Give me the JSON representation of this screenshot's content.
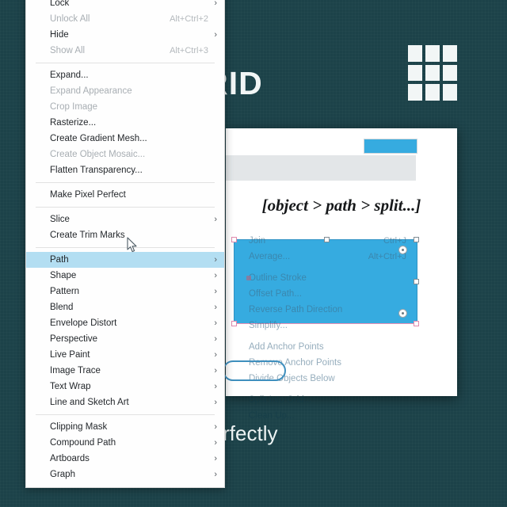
{
  "slide": {
    "title": "O GRID",
    "subtitle": "ting layouts with perfectly\ners.",
    "grid_icon": "grid-3x3-icon",
    "bg_color": "#1c4249",
    "accent_color": "#36abe0",
    "text_color": "#f2f6f6"
  },
  "panel": {
    "caption": "[object > path > split...]",
    "blue_bar_color": "#36abe0",
    "selection_color": "#36abe0"
  },
  "context_menu": {
    "items": [
      {
        "label": "Lock",
        "shortcut": "",
        "caret": "›",
        "state": "normal"
      },
      {
        "label": "Unlock All",
        "shortcut": "Alt+Ctrl+2",
        "caret": "",
        "state": "disabled"
      },
      {
        "label": "Hide",
        "shortcut": "",
        "caret": "›",
        "state": "normal"
      },
      {
        "label": "Show All",
        "shortcut": "Alt+Ctrl+3",
        "caret": "",
        "state": "disabled"
      },
      {
        "separator": true
      },
      {
        "label": "Expand...",
        "shortcut": "",
        "caret": "",
        "state": "normal"
      },
      {
        "label": "Expand Appearance",
        "shortcut": "",
        "caret": "",
        "state": "disabled"
      },
      {
        "label": "Crop Image",
        "shortcut": "",
        "caret": "",
        "state": "disabled"
      },
      {
        "label": "Rasterize...",
        "shortcut": "",
        "caret": "",
        "state": "normal"
      },
      {
        "label": "Create Gradient Mesh...",
        "shortcut": "",
        "caret": "",
        "state": "normal"
      },
      {
        "label": "Create Object Mosaic...",
        "shortcut": "",
        "caret": "",
        "state": "disabled"
      },
      {
        "label": "Flatten Transparency...",
        "shortcut": "",
        "caret": "",
        "state": "normal"
      },
      {
        "separator": true
      },
      {
        "label": "Make Pixel Perfect",
        "shortcut": "",
        "caret": "",
        "state": "normal"
      },
      {
        "separator": true
      },
      {
        "label": "Slice",
        "shortcut": "",
        "caret": "›",
        "state": "normal"
      },
      {
        "label": "Create Trim Marks",
        "shortcut": "",
        "caret": "",
        "state": "normal"
      },
      {
        "separator": true
      },
      {
        "label": "Path",
        "shortcut": "",
        "caret": "›",
        "state": "selected"
      },
      {
        "label": "Shape",
        "shortcut": "",
        "caret": "›",
        "state": "normal"
      },
      {
        "label": "Pattern",
        "shortcut": "",
        "caret": "›",
        "state": "normal"
      },
      {
        "label": "Blend",
        "shortcut": "",
        "caret": "›",
        "state": "normal"
      },
      {
        "label": "Envelope Distort",
        "shortcut": "",
        "caret": "›",
        "state": "normal"
      },
      {
        "label": "Perspective",
        "shortcut": "",
        "caret": "›",
        "state": "normal"
      },
      {
        "label": "Live Paint",
        "shortcut": "",
        "caret": "›",
        "state": "normal"
      },
      {
        "label": "Image Trace",
        "shortcut": "",
        "caret": "›",
        "state": "normal"
      },
      {
        "label": "Text Wrap",
        "shortcut": "",
        "caret": "›",
        "state": "normal"
      },
      {
        "label": "Line and Sketch Art",
        "shortcut": "",
        "caret": "›",
        "state": "normal"
      },
      {
        "separator": true
      },
      {
        "label": "Clipping Mask",
        "shortcut": "",
        "caret": "›",
        "state": "normal"
      },
      {
        "label": "Compound Path",
        "shortcut": "",
        "caret": "›",
        "state": "normal"
      },
      {
        "label": "Artboards",
        "shortcut": "",
        "caret": "›",
        "state": "normal"
      },
      {
        "label": "Graph",
        "shortcut": "",
        "caret": "›",
        "state": "normal"
      }
    ]
  },
  "path_submenu": {
    "items": [
      {
        "label": "Join",
        "shortcut": "Ctrl+J"
      },
      {
        "label": "Average...",
        "shortcut": "Alt+Ctrl+J"
      },
      {
        "separator": true
      },
      {
        "label": "Outline Stroke",
        "shortcut": ""
      },
      {
        "label": "Offset Path...",
        "shortcut": ""
      },
      {
        "label": "Reverse Path Direction",
        "shortcut": ""
      },
      {
        "label": "Simplify...",
        "shortcut": ""
      },
      {
        "separator": true
      },
      {
        "label": "Add Anchor Points",
        "shortcut": ""
      },
      {
        "label": "Remove Anchor Points",
        "shortcut": ""
      },
      {
        "label": "Divide Objects Below",
        "shortcut": ""
      },
      {
        "separator": true
      },
      {
        "label": "Split Into Grid...",
        "shortcut": ""
      },
      {
        "label": "Clean Up...",
        "shortcut": ""
      }
    ]
  },
  "annotation": {
    "shape": "ellipse-highlight",
    "color": "#3f8fbe"
  },
  "cursor": {
    "icon": "arrow-pointer-icon"
  }
}
